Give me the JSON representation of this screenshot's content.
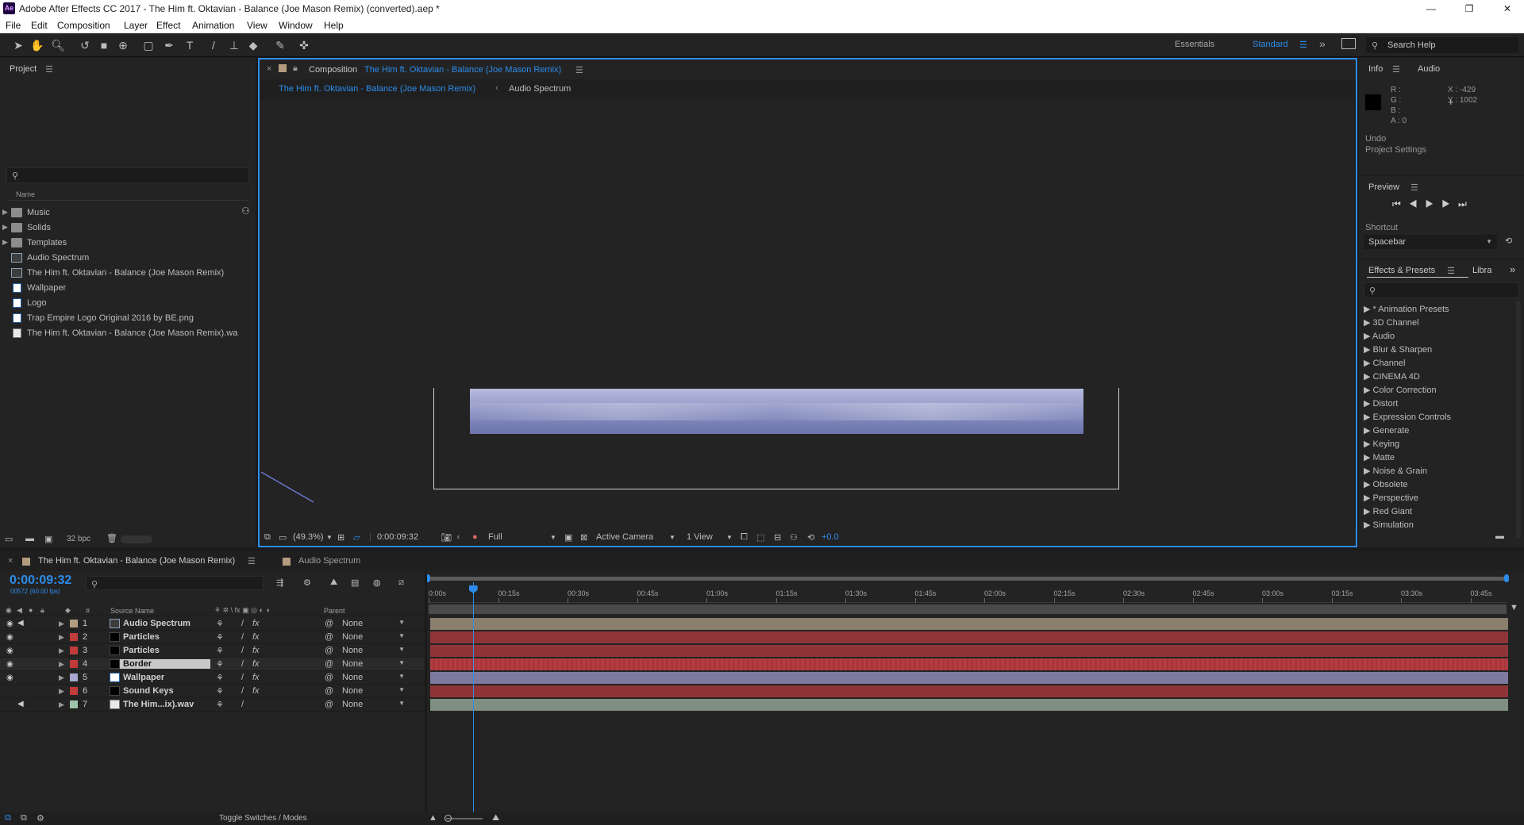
{
  "window": {
    "title": "Adobe After Effects CC 2017 - The Him ft. Oktavian - Balance (Joe Mason Remix) (converted).aep *",
    "app_badge": "Ae",
    "controls": {
      "minimize": "—",
      "restore": "❐",
      "close": "✕"
    }
  },
  "menu": [
    "File",
    "Edit",
    "Composition",
    "Layer",
    "Effect",
    "Animation",
    "View",
    "Window",
    "Help"
  ],
  "toolbar": {
    "workspaces": [
      "Essentials",
      "Standard"
    ],
    "active_workspace": "Standard",
    "search_help": "Search Help",
    "accent": "#2d8ceb"
  },
  "project": {
    "title": "Project",
    "column_name": "Name",
    "items": [
      {
        "name": "Music",
        "type": "folder"
      },
      {
        "name": "Solids",
        "type": "folder"
      },
      {
        "name": "Templates",
        "type": "folder"
      },
      {
        "name": "Audio Spectrum",
        "type": "composition"
      },
      {
        "name": "The Him ft. Oktavian - Balance (Joe Mason Remix)",
        "type": "composition"
      },
      {
        "name": "Wallpaper",
        "type": "solid"
      },
      {
        "name": "Logo",
        "type": "solid"
      },
      {
        "name": "Trap Empire Logo  Original 2016 by BE.png",
        "type": "solid"
      },
      {
        "name": "The Him ft. Oktavian - Balance (Joe Mason Remix).wa",
        "type": "audio"
      }
    ],
    "bit_depth": "32 bpc"
  },
  "composition": {
    "label": "Composition",
    "name": "The Him ft. Oktavian - Balance (Joe Mason Remix)",
    "breadcrumb": [
      "The Him ft. Oktavian - Balance (Joe Mason Remix)",
      "Audio Spectrum"
    ],
    "footer": {
      "zoom": "(49.3%)",
      "timecode": "0:00:09:32",
      "resolution": "Full",
      "camera": "Active Camera",
      "views": "1 View",
      "exposure": "+0.0"
    }
  },
  "info": {
    "tabs": [
      "Info",
      "Audio"
    ],
    "r": "R :",
    "g": "G :",
    "b": "B :",
    "a": "A : 0",
    "x": "X : -429",
    "y": "Y : 1002",
    "undo": "Undo",
    "undo_detail": "Project Settings"
  },
  "preview": {
    "title": "Preview",
    "shortcut_label": "Shortcut",
    "shortcut_value": "Spacebar"
  },
  "effects": {
    "tabs": [
      "Effects & Presets",
      "Libra"
    ],
    "items": [
      "* Animation Presets",
      "3D Channel",
      "Audio",
      "Blur & Sharpen",
      "Channel",
      "CINEMA 4D",
      "Color Correction",
      "Distort",
      "Expression Controls",
      "Generate",
      "Keying",
      "Matte",
      "Noise & Grain",
      "Obsolete",
      "Perspective",
      "Red Giant",
      "Simulation"
    ]
  },
  "timeline": {
    "tabs": [
      "The Him ft. Oktavian - Balance (Joe Mason Remix)",
      "Audio Spectrum"
    ],
    "timecode": "0:00:09:32",
    "frame_info": "00572 (60.00 fps)",
    "col_hash": "#",
    "col_source": "Source Name",
    "col_parent": "Parent",
    "ruler": [
      "0:00s",
      "00:15s",
      "00:30s",
      "00:45s",
      "01:00s",
      "01:15s",
      "01:30s",
      "01:45s",
      "02:00s",
      "02:15s",
      "02:30s",
      "02:45s",
      "03:00s",
      "03:15s",
      "03:30s",
      "03:45s"
    ],
    "playhead_seconds": 9.53,
    "layers": [
      {
        "num": "1",
        "name": "Audio Spectrum",
        "label_color": "#b39c7e",
        "icon": "comp",
        "parent": "None",
        "bar_color": "#8a7f6c",
        "visible": true,
        "audio": true,
        "fx": true
      },
      {
        "num": "2",
        "name": "Particles",
        "label_color": "#c23b3b",
        "icon": "solid-black",
        "parent": "None",
        "bar_color": "#8f3538",
        "visible": true,
        "audio": false,
        "fx": true
      },
      {
        "num": "3",
        "name": "Particles",
        "label_color": "#c23b3b",
        "icon": "solid-black",
        "parent": "None",
        "bar_color": "#8f3538",
        "visible": true,
        "audio": false,
        "fx": true
      },
      {
        "num": "4",
        "name": "Border",
        "label_color": "#c23b3b",
        "icon": "solid-black",
        "parent": "None",
        "bar_color": "#b53d42",
        "visible": true,
        "audio": false,
        "fx": true,
        "selected": true
      },
      {
        "num": "5",
        "name": "Wallpaper",
        "label_color": "#a8a6d0",
        "icon": "solid-white",
        "parent": "None",
        "bar_color": "#7e7a9e",
        "visible": true,
        "audio": false,
        "fx": true
      },
      {
        "num": "6",
        "name": "Sound Keys",
        "label_color": "#c23b3b",
        "icon": "solid-black",
        "parent": "None",
        "bar_color": "#8f3538",
        "visible": false,
        "audio": false,
        "fx": true
      },
      {
        "num": "7",
        "name": "The Him...ix).wav",
        "label_color": "#9ec3a8",
        "icon": "audio",
        "parent": "None",
        "bar_color": "#7e8e80",
        "visible": false,
        "audio": true,
        "fx": false
      }
    ],
    "toggle_label": "Toggle Switches / Modes"
  }
}
